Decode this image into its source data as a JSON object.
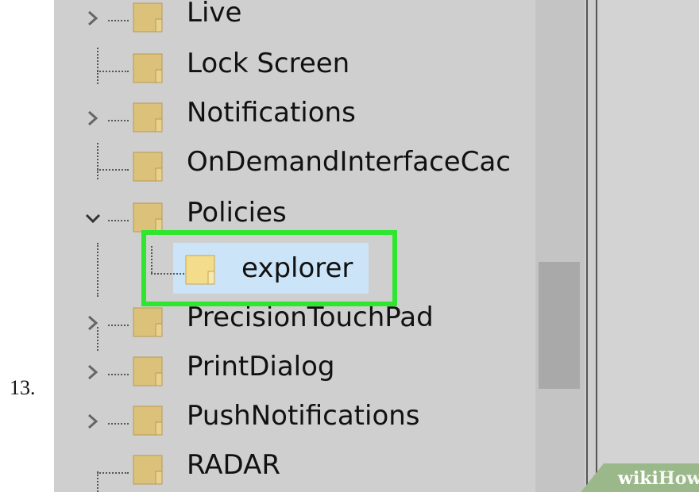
{
  "step": {
    "number": "13."
  },
  "tree": {
    "items": [
      {
        "label": "Live",
        "expander": "chevron-right"
      },
      {
        "label": "Lock Screen",
        "expander": "none"
      },
      {
        "label": "Notifications",
        "expander": "chevron-right"
      },
      {
        "label": "OnDemandInterfaceCac",
        "expander": "none"
      },
      {
        "label": "Policies",
        "expander": "chevron-down"
      },
      {
        "label": "explorer",
        "expander": "none",
        "selected": true
      },
      {
        "label": "PrecisionTouchPad",
        "expander": "chevron-right"
      },
      {
        "label": "PrintDialog",
        "expander": "chevron-right"
      },
      {
        "label": "PushNotifications",
        "expander": "chevron-right"
      },
      {
        "label": "RADAR",
        "expander": "none"
      }
    ]
  },
  "highlight": {
    "color": "#2ee62e"
  },
  "watermark": {
    "part1": "wiki",
    "part2": "How"
  }
}
